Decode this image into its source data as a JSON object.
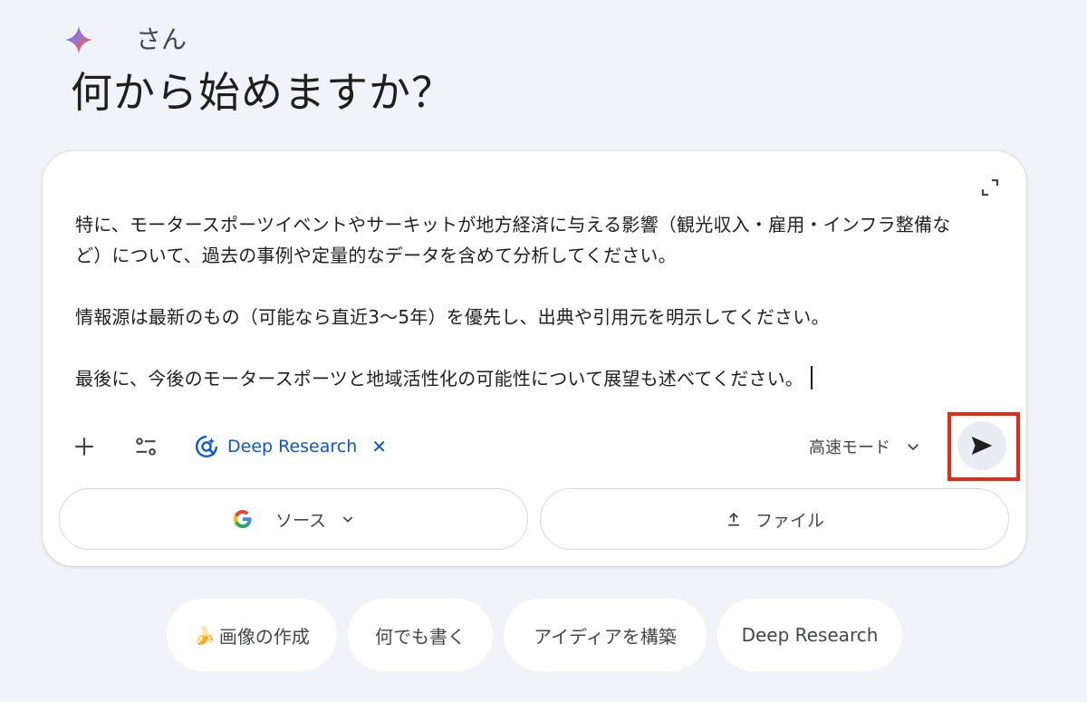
{
  "greeting": {
    "name_suffix": "さん",
    "headline": "何から始めますか？"
  },
  "prompt": {
    "paragraphs": [
      "特に、モータースポーツイベントやサーキットが地方経済に与える影響（観光収入・雇用・インフラ整備など）について、過去の事例や定量的なデータを含めて分析してください。",
      "情報源は最新のもの（可能なら直近3〜5年）を優先し、出典や引用元を明示してください。",
      "最後に、今後のモータースポーツと地域活性化の可能性について展望も述べてください。"
    ]
  },
  "toolbar": {
    "plus_icon": "plus-icon",
    "tools_icon": "tune-icon",
    "deep_research_label": "Deep Research",
    "deep_research_close": "✕",
    "mode_label": "高速モード",
    "send_icon": "send-icon"
  },
  "source_button": {
    "label": "ソース"
  },
  "file_button": {
    "label": "ファイル"
  },
  "suggestions": {
    "image": {
      "emoji": "🍌",
      "label": "画像の作成"
    },
    "write": "何でも書く",
    "ideas": "アイディアを構築",
    "deep_research": "Deep Research"
  },
  "colors": {
    "background": "#f0f4f9",
    "accent_blue": "#0b57d0",
    "highlight_red": "#e32b17"
  }
}
